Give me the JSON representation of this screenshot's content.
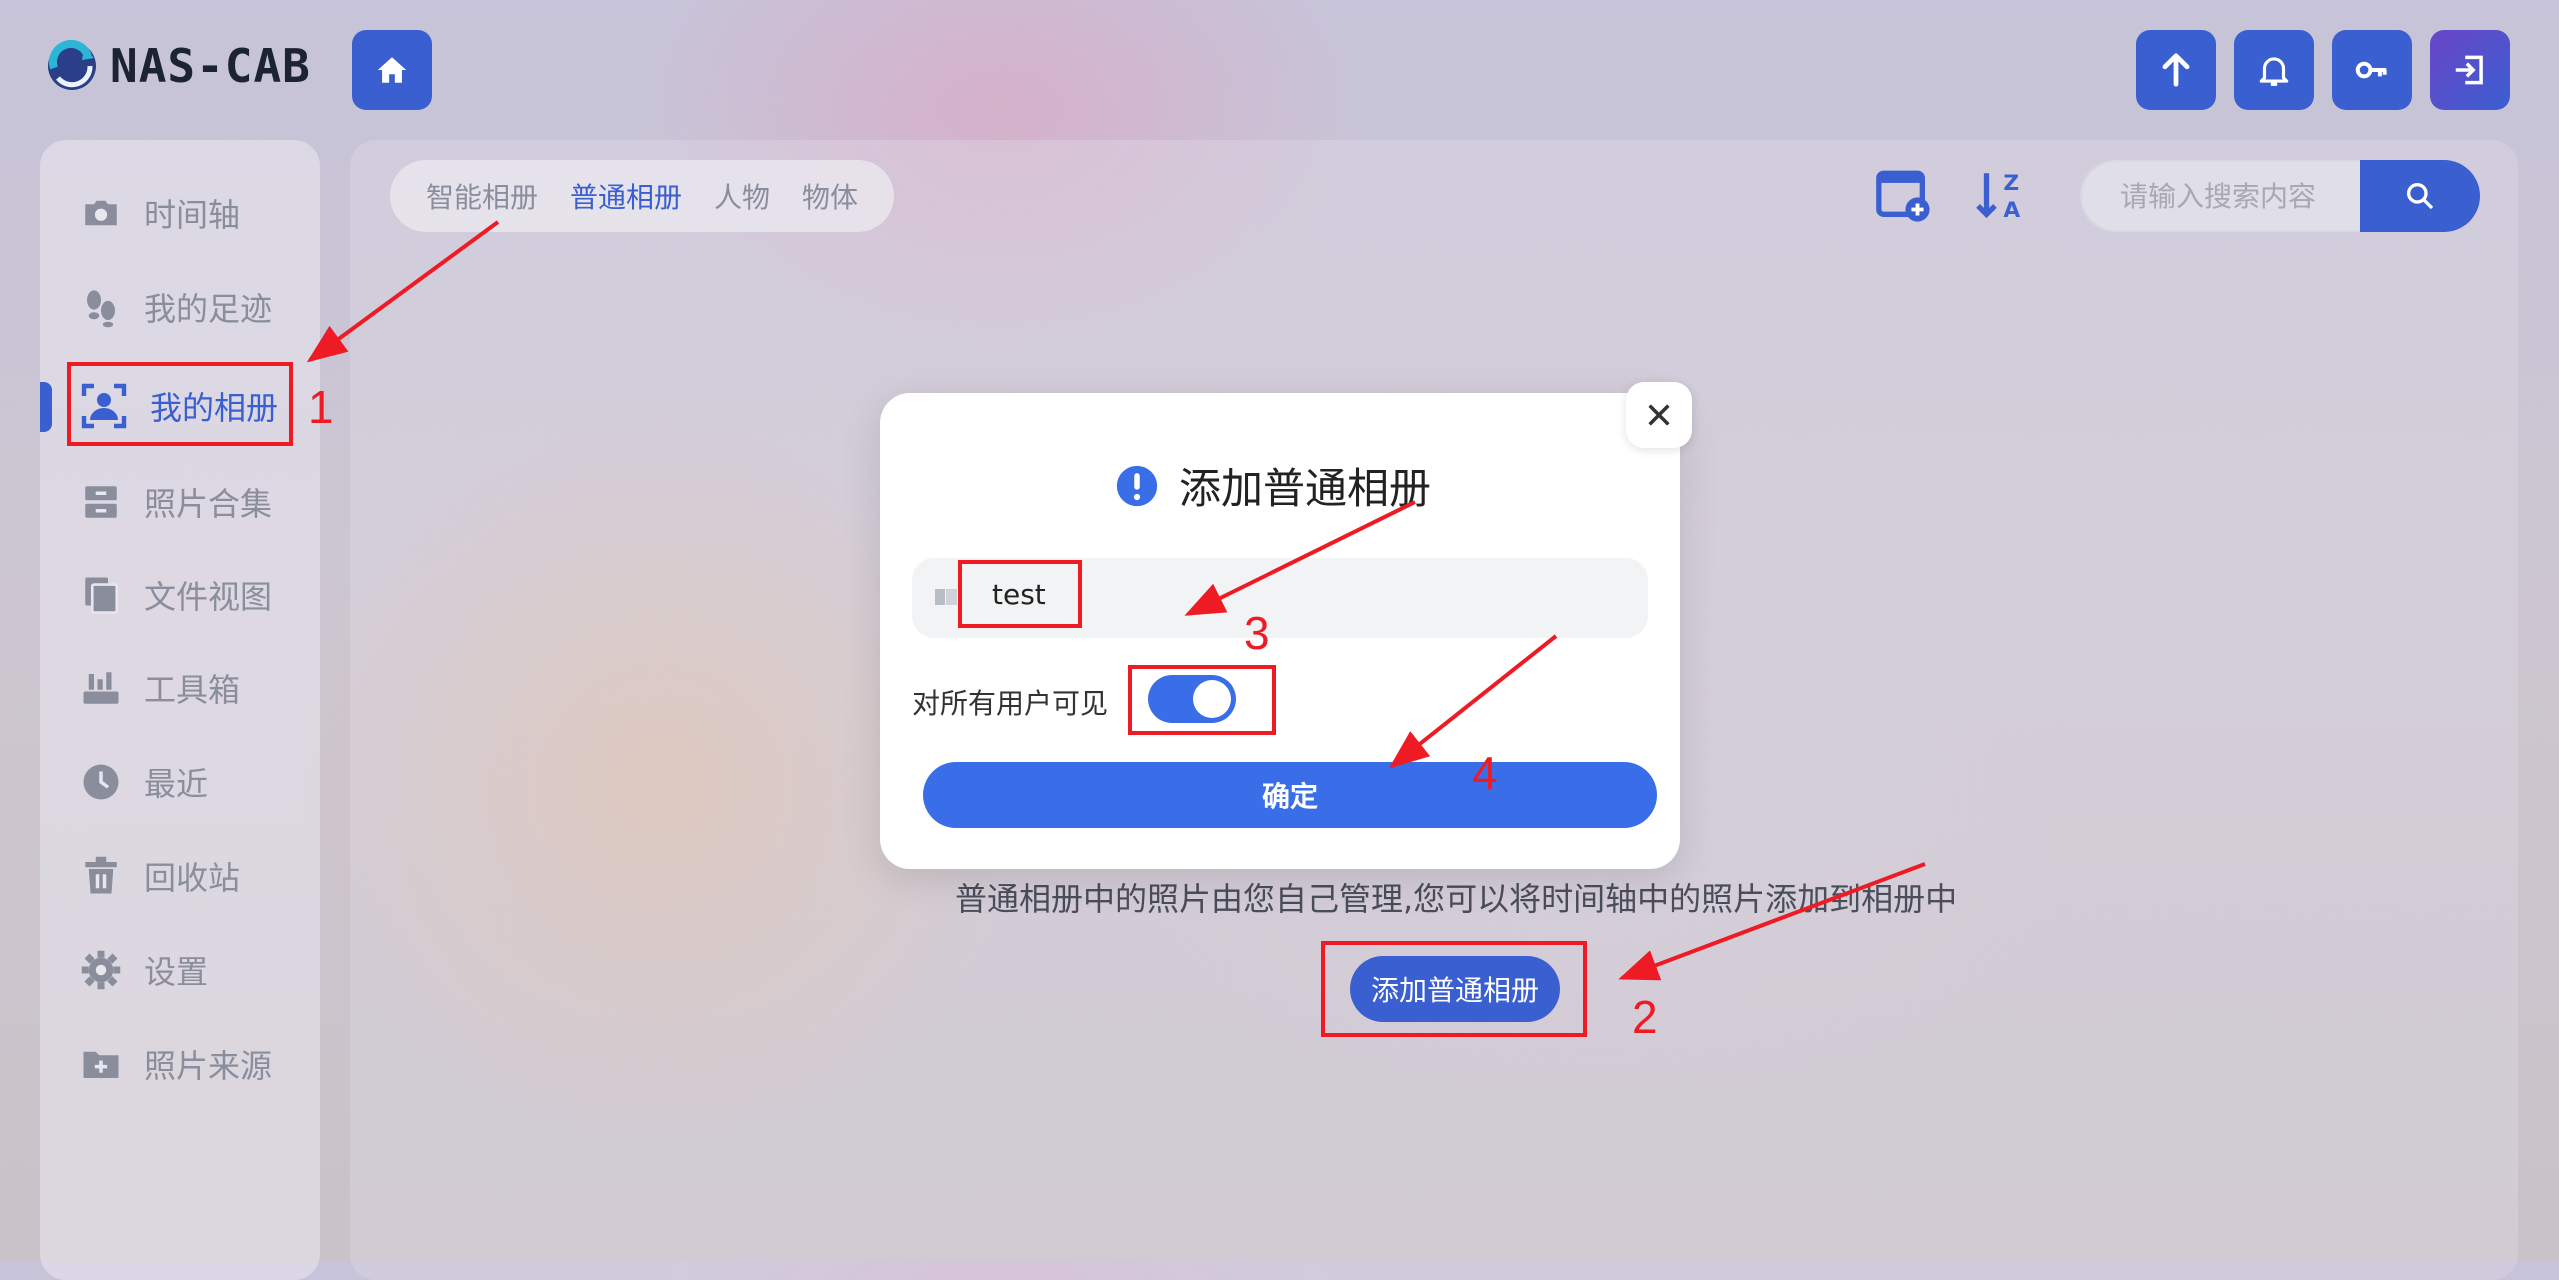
{
  "header": {
    "app_name": "NAS-CAB"
  },
  "sidebar": {
    "items": [
      {
        "label": "时间轴",
        "icon": "camera-icon"
      },
      {
        "label": "我的足迹",
        "icon": "footprints-icon"
      },
      {
        "label": "我的相册",
        "icon": "user-album-icon"
      },
      {
        "label": "照片合集",
        "icon": "archive-icon"
      },
      {
        "label": "文件视图",
        "icon": "files-icon"
      },
      {
        "label": "工具箱",
        "icon": "toolbox-icon"
      },
      {
        "label": "最近",
        "icon": "clock-icon"
      },
      {
        "label": "回收站",
        "icon": "trash-icon"
      },
      {
        "label": "设置",
        "icon": "gear-icon"
      },
      {
        "label": "照片来源",
        "icon": "folder-plus-icon"
      }
    ],
    "active_index": 2
  },
  "tabs": [
    "智能相册",
    "普通相册",
    "人物",
    "物体"
  ],
  "active_tab": 1,
  "search": {
    "placeholder": "请输入搜索内容"
  },
  "empty_state": {
    "description": "普通相册中的照片由您自己管理,您可以将时间轴中的照片添加到相册中",
    "add_button": "添加普通相册"
  },
  "modal": {
    "title": "添加普通相册",
    "name_value": "test",
    "visibility_label": "对所有用户可见",
    "visibility_on": true,
    "confirm": "确定"
  },
  "annotations": [
    "1",
    "2",
    "3",
    "4"
  ],
  "colors": {
    "accent": "#3a5fd0",
    "toggle": "#3a6ee8",
    "annotation": "#ee1b24"
  }
}
